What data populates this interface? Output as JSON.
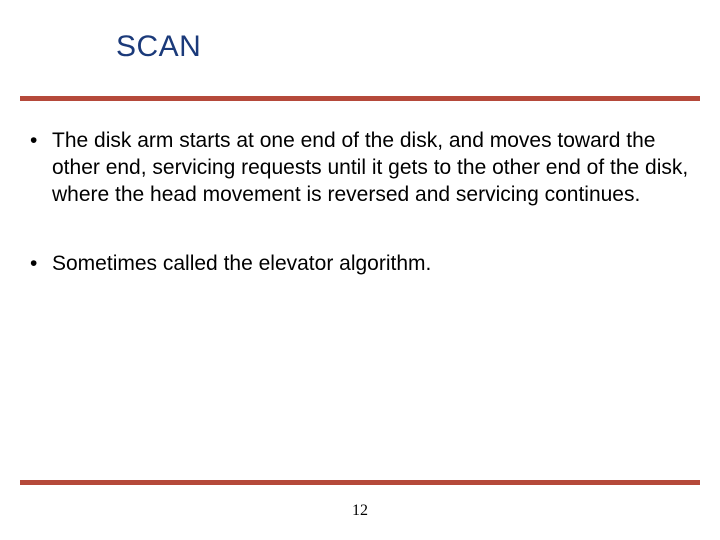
{
  "title": "SCAN",
  "bullets": [
    "The disk arm starts at one end of the disk, and moves toward the other end, servicing requests until it gets to the other end of the disk, where the head movement is reversed and servicing continues.",
    "Sometimes called the elevator algorithm."
  ],
  "page_number": "12",
  "colors": {
    "title": "#1b3a7a",
    "rule": "#b5493a"
  }
}
